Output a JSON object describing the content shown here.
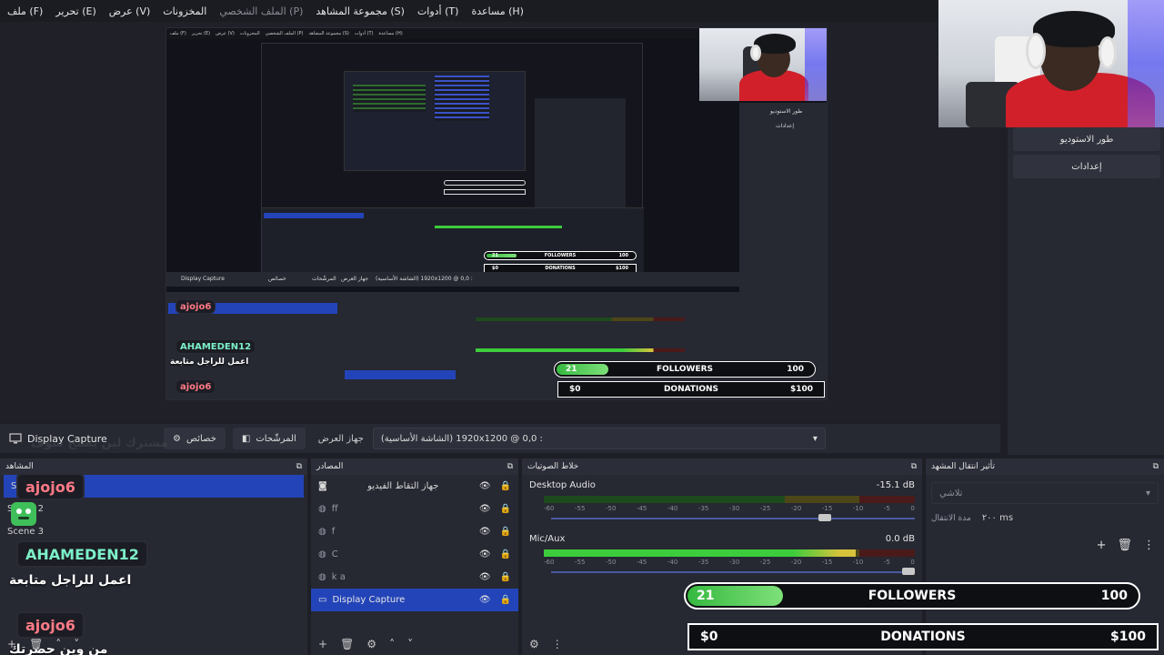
{
  "menu": [
    "ملف (F)",
    "تحرير (E)",
    "عرض (V)",
    "المخزونات",
    "الملف الشخصي (P)",
    "مجموعة المشاهد (S)",
    "أدوات (T)",
    "مساعدة (H)"
  ],
  "right_panel": {
    "studio_mode": "طور الاستوديو",
    "settings": "إعدادات"
  },
  "controls": {
    "source_name": "Display Capture",
    "properties": "خصائص",
    "filters": "المرشّحات",
    "display_label": "جهاز العرض",
    "display_value": "(الشاشة الأساسية) 1920x1200 @ 0,0 :"
  },
  "docks": {
    "scenes_title": "المشاهد",
    "sources_title": "المصادر",
    "mixer_title": "خلاط الصوتيات",
    "transitions_title": "تأثير انتقال المشهد"
  },
  "scenes": [
    {
      "label": "S",
      "active": true
    },
    {
      "label": "Scene 2",
      "active": false
    },
    {
      "label": "Scene 3",
      "active": false
    }
  ],
  "sources": [
    {
      "label": "جهاز التقاط الفيديو",
      "icon": "camera-icon",
      "active": false
    },
    {
      "label": "ff",
      "icon": "globe-icon",
      "active": false
    },
    {
      "label": "f",
      "icon": "globe-icon",
      "active": false
    },
    {
      "label": "C",
      "icon": "globe-icon",
      "active": false
    },
    {
      "label": "k a",
      "icon": "globe-icon",
      "active": false
    },
    {
      "label": "Display Capture",
      "icon": "monitor-icon",
      "active": true
    }
  ],
  "mixer": {
    "channels": [
      {
        "name": "Desktop Audio",
        "db": "-15.1 dB",
        "level": 0.0,
        "volume": 0.77
      },
      {
        "name": "Mic/Aux",
        "db": "0.0 dB",
        "level": 0.84,
        "volume": 1.0
      }
    ],
    "ticks": [
      "-60",
      "-55",
      "-50",
      "-45",
      "-40",
      "-35",
      "-30",
      "-25",
      "-20",
      "-15",
      "-10",
      "-5",
      "0"
    ]
  },
  "transitions": {
    "type": "تلاشي",
    "duration_label": "مدة الانتقال",
    "duration_value": "٢٠٠ ms"
  },
  "overlay": {
    "chat": [
      {
        "user": "ajojo6",
        "message": ""
      },
      {
        "user": "AHAMEDEN12",
        "message": "اعمل للراجل متابعة"
      },
      {
        "user": "ajojo6",
        "message": "من وين حضرتك"
      }
    ],
    "watermark": "مشترك لين يصبح سوف",
    "followers": {
      "current": "21",
      "label": "FOLLOWERS",
      "goal": "100",
      "progress": 0.21
    },
    "donations": {
      "current": "$0",
      "label": "DONATIONS",
      "goal": "$100",
      "progress": 0.0
    }
  },
  "colors": {
    "accent": "#2344b8",
    "goal_green": "#36b940",
    "chat_name": "#ff7a86",
    "chat_name_alt": "#7cf0c8"
  }
}
